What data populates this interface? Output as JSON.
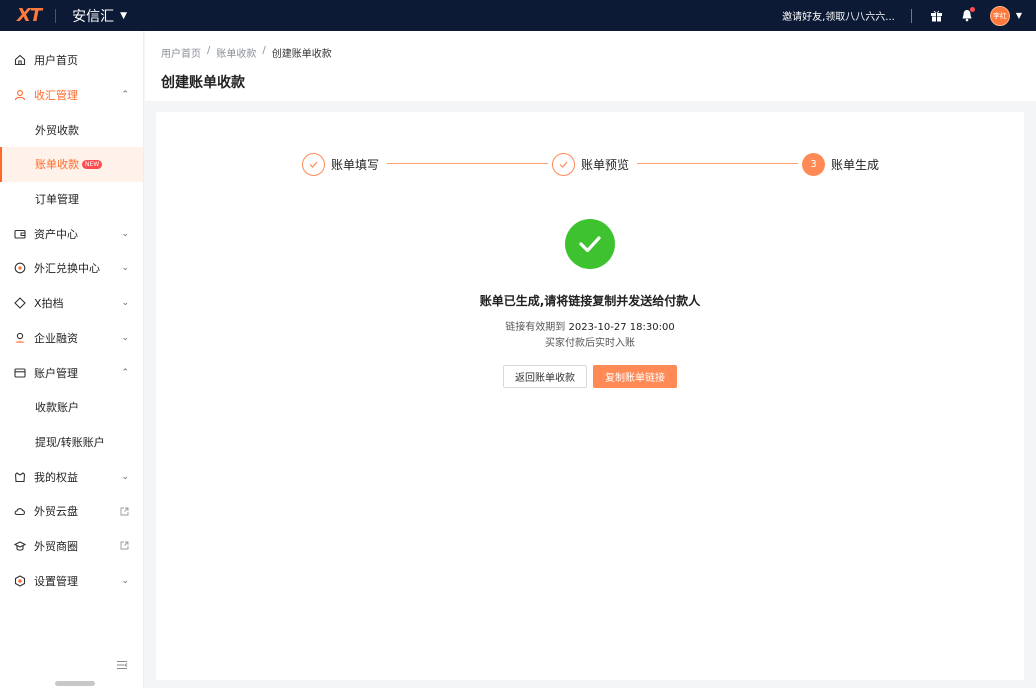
{
  "topbar": {
    "logo": "XT",
    "brand": "安信汇",
    "invite_text": "邀请好友,领取八八六六...",
    "avatar_text": "李红"
  },
  "sidebar": {
    "items": [
      {
        "label": "用户首页",
        "icon": "home-icon"
      },
      {
        "label": "收汇管理",
        "icon": "user-icon",
        "arrow": "⌃"
      },
      {
        "label": "外贸收款"
      },
      {
        "label": "账单收款",
        "badge": "NEW"
      },
      {
        "label": "订单管理"
      },
      {
        "label": "资产中心",
        "icon": "wallet-icon",
        "arrow": "⌄"
      },
      {
        "label": "外汇兑换中心",
        "icon": "exchange-icon",
        "arrow": "⌄"
      },
      {
        "label": "X拍档",
        "icon": "tag-icon",
        "arrow": "⌄"
      },
      {
        "label": "企业融资",
        "icon": "finance-icon",
        "arrow": "⌄"
      },
      {
        "label": "账户管理",
        "icon": "card-icon",
        "arrow": "⌃"
      },
      {
        "label": "收款账户"
      },
      {
        "label": "提现/转账账户"
      },
      {
        "label": "我的权益",
        "icon": "gift-box-icon",
        "arrow": "⌄"
      },
      {
        "label": "外贸云盘",
        "icon": "cloud-icon"
      },
      {
        "label": "外贸商圈",
        "icon": "graduation-icon"
      },
      {
        "label": "设置管理",
        "icon": "settings-icon",
        "arrow": "⌄"
      }
    ]
  },
  "breadcrumb": {
    "items": [
      "用户首页",
      "账单收款",
      "创建账单收款"
    ],
    "sep": "/"
  },
  "page_title": "创建账单收款",
  "steps": [
    {
      "label": "账单填写",
      "state": "done"
    },
    {
      "label": "账单预览",
      "state": "done"
    },
    {
      "label": "账单生成",
      "state": "current",
      "number": "3"
    }
  ],
  "result": {
    "title": "账单已生成,请将链接复制并发送给付款人",
    "expiry_prefix": "链接有效期到",
    "expiry_date": "2023-10-27 18:30:00",
    "note": "买家付款后实时入账"
  },
  "buttons": {
    "back": "返回账单收款",
    "copy": "复制账单链接"
  },
  "colors": {
    "accent": "#ff8a55",
    "success": "#3fc230",
    "topbar": "#0c1a36"
  }
}
